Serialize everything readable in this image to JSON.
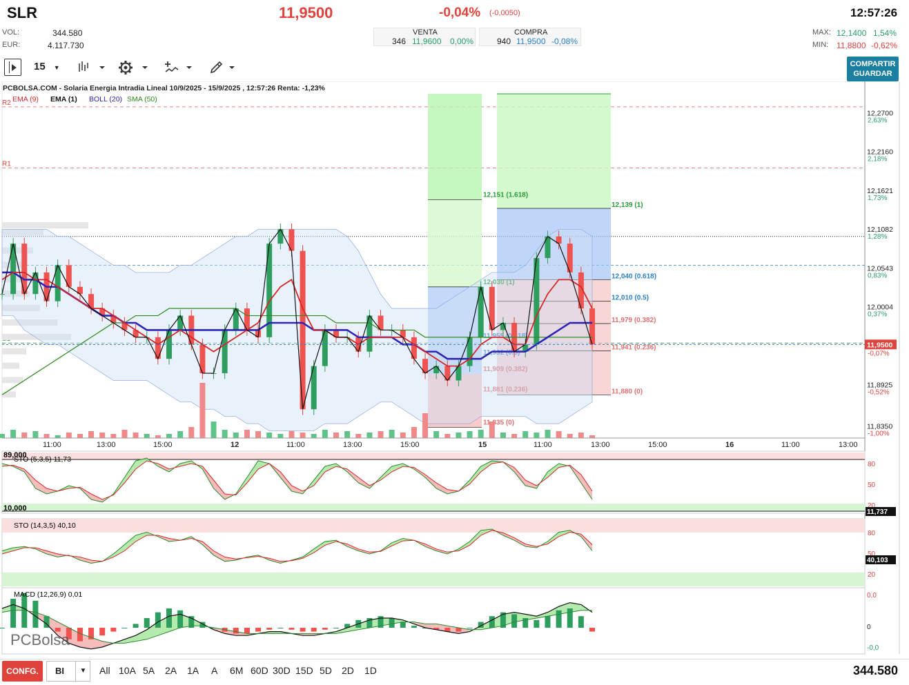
{
  "header": {
    "ticker": "SLR",
    "last": "11,9500",
    "change_pct": "-0,04%",
    "change_abs": "(-0,0050)",
    "time": "12:57:26",
    "vol_label": "VOL:",
    "vol": "344.580",
    "eur_label": "EUR:",
    "eur": "4.117.730",
    "sell": {
      "label": "VENTA",
      "qty": "346",
      "price": "11,9600",
      "pct": "0,00%"
    },
    "buy": {
      "label": "COMPRA",
      "qty": "940",
      "price": "11,9500",
      "pct": "-0,08%"
    },
    "max_label": "MAX:",
    "max": "12,1400",
    "max_pct": "1,54%",
    "min_label": "MIN:",
    "min": "11,8800",
    "min_pct": "-0,62%"
  },
  "toolbar": {
    "interval": "15",
    "share": "COMPARTIR",
    "save": "GUARDAR",
    "icons": [
      "panel-toggle-icon",
      "interval-dropdown",
      "candles-icon",
      "settings-icon",
      "indicators-icon",
      "drawing-icon"
    ]
  },
  "chart_title": "PCBOLSA.COM - Solaria Energia Intradia Lineal 10/9/2025 - 15/9/2025 , 12:57:26 Renta: -1,23%",
  "legend": [
    {
      "name": "EMA (9)",
      "color": "#d62728"
    },
    {
      "name": "EMA (1)",
      "color": "#111111"
    },
    {
      "name": "BOLL (20)",
      "color": "#2e24b8"
    },
    {
      "name": "SMA (50)",
      "color": "#2f8a1f"
    }
  ],
  "chart_data": {
    "type": "line",
    "price_axis": {
      "ticks": [
        "12,2700",
        "12,2160",
        "12,1621",
        "12,1082",
        "12,0543",
        "12,0004",
        "11,8925",
        "11,8350"
      ],
      "pct": [
        "2,63%",
        "2,18%",
        "1,73%",
        "1,28%",
        "0,83%",
        "0,37%",
        "-0,52%",
        "-1,00%"
      ],
      "last_label": "11,9500",
      "last_pct": "-0,07%"
    },
    "ylim": [
      11.82,
      12.3
    ],
    "x_labels": [
      "11:00",
      "13:00",
      "15:00",
      "12",
      "11:00",
      "13:00",
      "15:00",
      "15",
      "11:00",
      "13:00",
      "15:00",
      "16",
      "11:00",
      "13:00"
    ],
    "pivots": [
      {
        "name": "R2",
        "value": 12.28
      },
      {
        "name": "R1",
        "value": 12.195
      },
      {
        "name": "S1",
        "value": 11.952
      }
    ],
    "ema1": [
      12.02,
      12.09,
      12.02,
      12.05,
      12.01,
      12.06,
      12.03,
      12.02,
      12.0,
      11.99,
      11.98,
      11.97,
      11.96,
      11.96,
      11.93,
      11.97,
      11.99,
      11.95,
      11.91,
      11.91,
      11.97,
      12.0,
      11.97,
      11.96,
      12.09,
      12.11,
      12.08,
      11.86,
      11.92,
      11.97,
      11.96,
      11.96,
      11.94,
      11.99,
      11.97,
      11.97,
      11.96,
      11.93,
      11.91,
      11.92,
      11.9,
      11.92,
      11.96,
      12.03,
      11.97,
      11.98,
      11.94,
      11.95,
      12.07,
      12.1,
      12.09,
      12.05,
      12.0,
      11.95
    ],
    "ema9": [
      12.04,
      12.05,
      12.05,
      12.04,
      12.04,
      12.03,
      12.02,
      12.01,
      12.0,
      12.0,
      11.99,
      11.98,
      11.97,
      11.96,
      11.95,
      11.96,
      11.97,
      11.96,
      11.95,
      11.94,
      11.95,
      11.96,
      11.97,
      11.98,
      12.01,
      12.03,
      12.04,
      12.0,
      11.97,
      11.97,
      11.96,
      11.96,
      11.95,
      11.96,
      11.96,
      11.96,
      11.96,
      11.95,
      11.94,
      11.93,
      11.92,
      11.92,
      11.93,
      11.95,
      11.96,
      11.96,
      11.95,
      11.95,
      11.99,
      12.02,
      12.04,
      12.04,
      12.03,
      12.0
    ],
    "boll_mid": [
      12.05,
      12.05,
      12.04,
      12.04,
      12.03,
      12.03,
      12.02,
      12.01,
      12.0,
      11.99,
      11.99,
      11.98,
      11.98,
      11.97,
      11.97,
      11.97,
      11.97,
      11.97,
      11.97,
      11.97,
      11.97,
      11.97,
      11.97,
      11.97,
      11.98,
      11.98,
      11.98,
      11.98,
      11.97,
      11.97,
      11.97,
      11.97,
      11.96,
      11.96,
      11.96,
      11.96,
      11.95,
      11.95,
      11.94,
      11.94,
      11.93,
      11.93,
      11.93,
      11.93,
      11.94,
      11.94,
      11.94,
      11.94,
      11.95,
      11.96,
      11.97,
      11.98,
      11.98,
      11.98
    ],
    "boll_up": [
      12.11,
      12.11,
      12.11,
      12.11,
      12.11,
      12.1,
      12.1,
      12.09,
      12.08,
      12.07,
      12.06,
      12.06,
      12.05,
      12.05,
      12.05,
      12.05,
      12.06,
      12.06,
      12.07,
      12.08,
      12.09,
      12.1,
      12.1,
      12.11,
      12.11,
      12.11,
      12.11,
      12.11,
      12.11,
      12.11,
      12.11,
      12.1,
      12.08,
      12.05,
      12.02,
      12.0,
      12.0,
      12.0,
      12.0,
      12.0,
      12.01,
      12.02,
      12.03,
      12.04,
      12.05,
      12.05,
      12.05,
      12.06,
      12.08,
      12.1,
      12.11,
      12.11,
      12.11,
      12.1
    ],
    "boll_low": [
      11.99,
      11.99,
      11.97,
      11.96,
      11.95,
      11.95,
      11.94,
      11.93,
      11.92,
      11.91,
      11.9,
      11.9,
      11.9,
      11.9,
      11.89,
      11.88,
      11.87,
      11.87,
      11.86,
      11.86,
      11.85,
      11.85,
      11.84,
      11.84,
      11.83,
      11.83,
      11.83,
      11.83,
      11.83,
      11.84,
      11.84,
      11.84,
      11.85,
      11.86,
      11.87,
      11.87,
      11.86,
      11.85,
      11.84,
      11.84,
      11.84,
      11.84,
      11.84,
      11.85,
      11.85,
      11.85,
      11.85,
      11.85,
      11.84,
      11.84,
      11.84,
      11.85,
      11.86,
      11.87
    ],
    "sma50": [
      11.88,
      11.89,
      11.9,
      11.91,
      11.92,
      11.93,
      11.94,
      11.95,
      11.96,
      11.97,
      11.98,
      11.98,
      11.99,
      11.99,
      11.99,
      12.0,
      12.0,
      12.0,
      12.0,
      12.0,
      12.0,
      12.0,
      11.99,
      11.99,
      11.99,
      11.99,
      11.99,
      11.99,
      11.99,
      11.99,
      11.98,
      11.98,
      11.98,
      11.98,
      11.97,
      11.97,
      11.97,
      11.97,
      11.96,
      11.96,
      11.96,
      11.96,
      11.96,
      11.96,
      11.96,
      11.96,
      11.96,
      11.96,
      11.96,
      11.96,
      11.96,
      11.96,
      11.96,
      11.96
    ],
    "volume": [
      3,
      6,
      4,
      5,
      3,
      2,
      4,
      3,
      5,
      4,
      3,
      6,
      4,
      3,
      2,
      3,
      5,
      8,
      40,
      12,
      6,
      4,
      6,
      5,
      4,
      3,
      5,
      4,
      3,
      6,
      4,
      5,
      3,
      4,
      5,
      6,
      4,
      8,
      18,
      5,
      3,
      4,
      5,
      6,
      12,
      4,
      3,
      5,
      4,
      6,
      5,
      3,
      4,
      2
    ],
    "fibo_left": {
      "levels": [
        "12,151 (1.618)",
        "12,030 (1)",
        "11,955 (0.618)",
        "11,932 (0.5)",
        "11,909 (0.382)",
        "11,881 (0.236)",
        "11,835 (0)"
      ]
    },
    "fibo_right": {
      "levels": [
        "12,139 (1)",
        "12,040 (0.618)",
        "12,010 (0.5)",
        "11,979 (0.382)",
        "11,941 (0.236)",
        "11,880 (0)"
      ]
    },
    "sto1": {
      "label": "STO (5,3,5)",
      "value": "11,73",
      "axis": [
        "80",
        "50",
        "20"
      ],
      "last": "11,737",
      "top": "89,000",
      "bottom": "10,000",
      "k": [
        85,
        80,
        70,
        40,
        30,
        35,
        45,
        40,
        20,
        15,
        30,
        60,
        90,
        95,
        80,
        70,
        85,
        90,
        75,
        40,
        20,
        30,
        60,
        90,
        85,
        60,
        35,
        30,
        55,
        80,
        85,
        70,
        50,
        40,
        60,
        80,
        85,
        75,
        60,
        40,
        30,
        35,
        55,
        80,
        90,
        88,
        70,
        45,
        40,
        70,
        85,
        80,
        50,
        20
      ],
      "d": [
        80,
        82,
        75,
        55,
        40,
        35,
        40,
        42,
        30,
        20,
        28,
        50,
        75,
        90,
        85,
        75,
        80,
        85,
        80,
        55,
        30,
        28,
        50,
        75,
        85,
        70,
        45,
        35,
        45,
        70,
        80,
        75,
        60,
        45,
        55,
        70,
        80,
        78,
        65,
        50,
        38,
        35,
        48,
        70,
        85,
        88,
        78,
        55,
        45,
        60,
        78,
        82,
        65,
        35
      ]
    },
    "sto2": {
      "label": "STO (14,3,5)",
      "value": "40,10",
      "axis": [
        "80",
        "50",
        "20"
      ],
      "last": "40,103",
      "k": [
        55,
        60,
        62,
        58,
        50,
        45,
        48,
        40,
        35,
        38,
        50,
        65,
        80,
        85,
        78,
        70,
        72,
        78,
        65,
        48,
        38,
        40,
        45,
        48,
        40,
        35,
        40,
        45,
        58,
        70,
        72,
        62,
        55,
        50,
        55,
        68,
        75,
        72,
        62,
        55,
        50,
        58,
        70,
        88,
        90,
        80,
        72,
        62,
        60,
        70,
        85,
        88,
        78,
        55
      ],
      "d": [
        50,
        55,
        60,
        60,
        55,
        50,
        47,
        45,
        40,
        38,
        45,
        55,
        70,
        80,
        80,
        75,
        72,
        75,
        70,
        55,
        45,
        42,
        44,
        46,
        43,
        38,
        39,
        43,
        52,
        64,
        70,
        66,
        58,
        53,
        54,
        63,
        71,
        72,
        66,
        58,
        53,
        55,
        64,
        80,
        88,
        84,
        76,
        66,
        62,
        66,
        78,
        85,
        82,
        65
      ]
    },
    "macd": {
      "label": "MACD (12,26,9)",
      "value": "0,01",
      "axis": [
        "0,0",
        "0",
        "-0,0"
      ],
      "hist": [
        0,
        15,
        18,
        14,
        6,
        -2,
        -6,
        -7,
        -6,
        -4,
        -2,
        0,
        2,
        5,
        8,
        10,
        9,
        6,
        3,
        0,
        -2,
        -3,
        -3,
        -2,
        -1,
        0,
        -1,
        -2,
        -2,
        -1,
        0,
        2,
        4,
        5,
        6,
        5,
        3,
        1,
        0,
        -1,
        -2,
        -2,
        0,
        3,
        6,
        8,
        7,
        5,
        4,
        6,
        9,
        10,
        6,
        -2
      ],
      "line": [
        10,
        12,
        10,
        6,
        2,
        -4,
        -8,
        -10,
        -11,
        -10,
        -8,
        -6,
        -4,
        -1,
        3,
        6,
        7,
        5,
        2,
        -1,
        -3,
        -4,
        -4,
        -3,
        -2,
        -2,
        -3,
        -4,
        -4,
        -3,
        -2,
        0,
        2,
        4,
        5,
        5,
        4,
        2,
        0,
        -1,
        -2,
        -3,
        -2,
        1,
        4,
        7,
        8,
        7,
        6,
        8,
        11,
        13,
        12,
        8
      ],
      "signal": [
        8,
        9,
        9,
        8,
        6,
        3,
        0,
        -3,
        -5,
        -7,
        -8,
        -8,
        -7,
        -6,
        -4,
        -2,
        0,
        1,
        1,
        0,
        -1,
        -2,
        -3,
        -3,
        -3,
        -3,
        -3,
        -3,
        -3,
        -3,
        -3,
        -2,
        -1,
        0,
        1,
        2,
        3,
        3,
        2,
        2,
        1,
        0,
        -1,
        -1,
        0,
        1,
        3,
        4,
        5,
        6,
        7,
        8,
        9,
        9
      ]
    }
  },
  "watermark": "PCBolsa",
  "bottom": {
    "config": "CONFG.",
    "mode": "BI",
    "periods": [
      "All",
      "10A",
      "5A",
      "2A",
      "1A",
      "A",
      "6M",
      "60D",
      "30D",
      "15D",
      "5D",
      "2D",
      "1D"
    ],
    "volume": "344.580"
  }
}
